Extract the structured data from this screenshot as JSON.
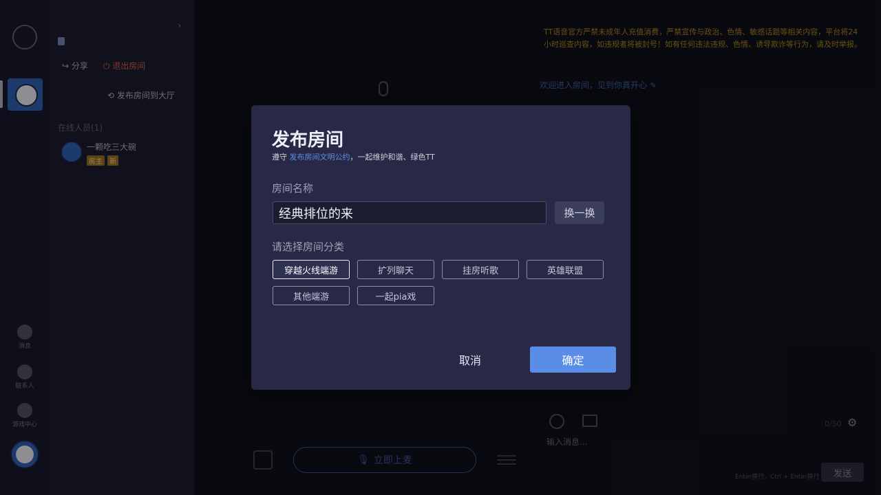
{
  "window": {
    "minimize": "—",
    "maximize": "☐",
    "close": "✕"
  },
  "left_rail": {
    "items": [
      {
        "label": "消息"
      },
      {
        "label": "联系人"
      },
      {
        "label": "游戏中心"
      }
    ]
  },
  "room_panel": {
    "share_label": "分享",
    "leave_label": "退出房间",
    "publish_label": "发布房间到大厅",
    "online_label": "在线人员(1)",
    "members": [
      {
        "name": "一颗吃三大碗",
        "badges": [
          "房主",
          "新"
        ]
      }
    ]
  },
  "stage": {
    "on_mic_label": "立即上麦"
  },
  "chat": {
    "notice": "TT语音官方严禁未成年人充值消费，严禁宣传与政治、色情、敏感话题等相关内容，平台将24小时巡查内容，如违规者将被封号！如有任何违法违规、色情、诱导欺诈等行为，请及时举报。",
    "welcome": "欢迎进入房间，见到你真开心",
    "counter": "0/50",
    "input_placeholder": "输入消息...",
    "hint": "Enter换行，Ctrl + Enter换行",
    "send_label": "发送"
  },
  "modal": {
    "title": "发布房间",
    "rule_prefix": "遵守 ",
    "rule_link": "发布房间文明公约",
    "rule_suffix": "，一起维护和谐、绿色TT",
    "name_label": "房间名称",
    "name_value": "经典排位的来",
    "swap_label": "换一换",
    "category_label": "请选择房间分类",
    "categories": [
      {
        "label": "穿越火线端游",
        "selected": true
      },
      {
        "label": "扩列聊天",
        "selected": false
      },
      {
        "label": "挂房听歌",
        "selected": false
      },
      {
        "label": "英雄联盟",
        "selected": false
      },
      {
        "label": "其他端游",
        "selected": false
      },
      {
        "label": "一起pia戏",
        "selected": false
      }
    ],
    "cancel_label": "取消",
    "confirm_label": "确定"
  }
}
